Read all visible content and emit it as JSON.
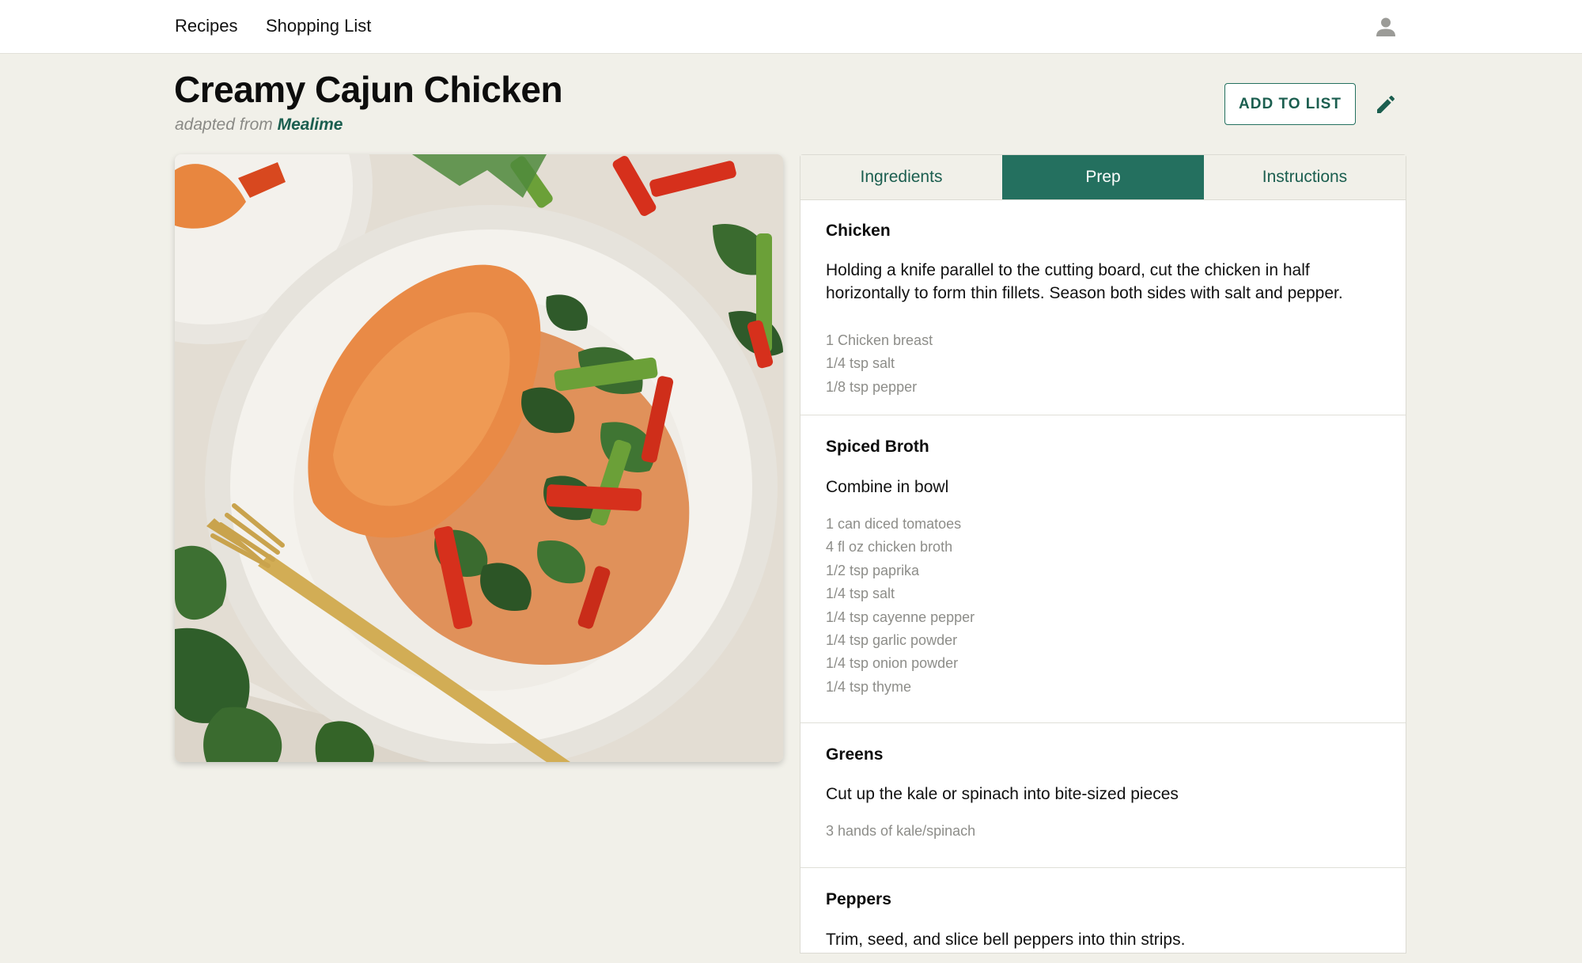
{
  "nav": {
    "recipes": "Recipes",
    "shopping_list": "Shopping List",
    "user_icon": "user-icon"
  },
  "recipe": {
    "title": "Creamy Cajun Chicken",
    "adapted_prefix": "adapted from",
    "source": "Mealime",
    "add_button": "ADD TO LIST",
    "edit_icon": "pencil-icon"
  },
  "tabs": [
    {
      "label": "Ingredients",
      "active": false
    },
    {
      "label": "Prep",
      "active": true
    },
    {
      "label": "Instructions",
      "active": false
    }
  ],
  "prep_sections": [
    {
      "title": "Chicken",
      "description": "Holding a knife parallel to the cutting board, cut the chicken in half horizontally to form thin fillets. Season both sides with salt and pepper.",
      "ingredients": [
        "1 Chicken breast",
        "1/4 tsp salt",
        "1/8 tsp pepper"
      ]
    },
    {
      "title": "Spiced Broth",
      "description": "Combine in bowl",
      "ingredients": [
        "1 can diced tomatoes",
        "4 fl oz chicken broth",
        "1/2 tsp paprika",
        "1/4 tsp salt",
        "1/4 tsp cayenne pepper",
        "1/4 tsp garlic powder",
        "1/4 tsp onion powder",
        "1/4 tsp thyme"
      ]
    },
    {
      "title": "Greens",
      "description": "Cut up the kale or spinach into bite-sized pieces",
      "ingredients": [
        "3 hands of kale/spinach"
      ]
    },
    {
      "title": "Peppers",
      "description": "Trim, seed, and slice bell peppers into thin strips.",
      "ingredients": []
    }
  ],
  "colors": {
    "background": "#f1f0e9",
    "accent": "#24705f",
    "muted_text": "#8d8d89"
  }
}
